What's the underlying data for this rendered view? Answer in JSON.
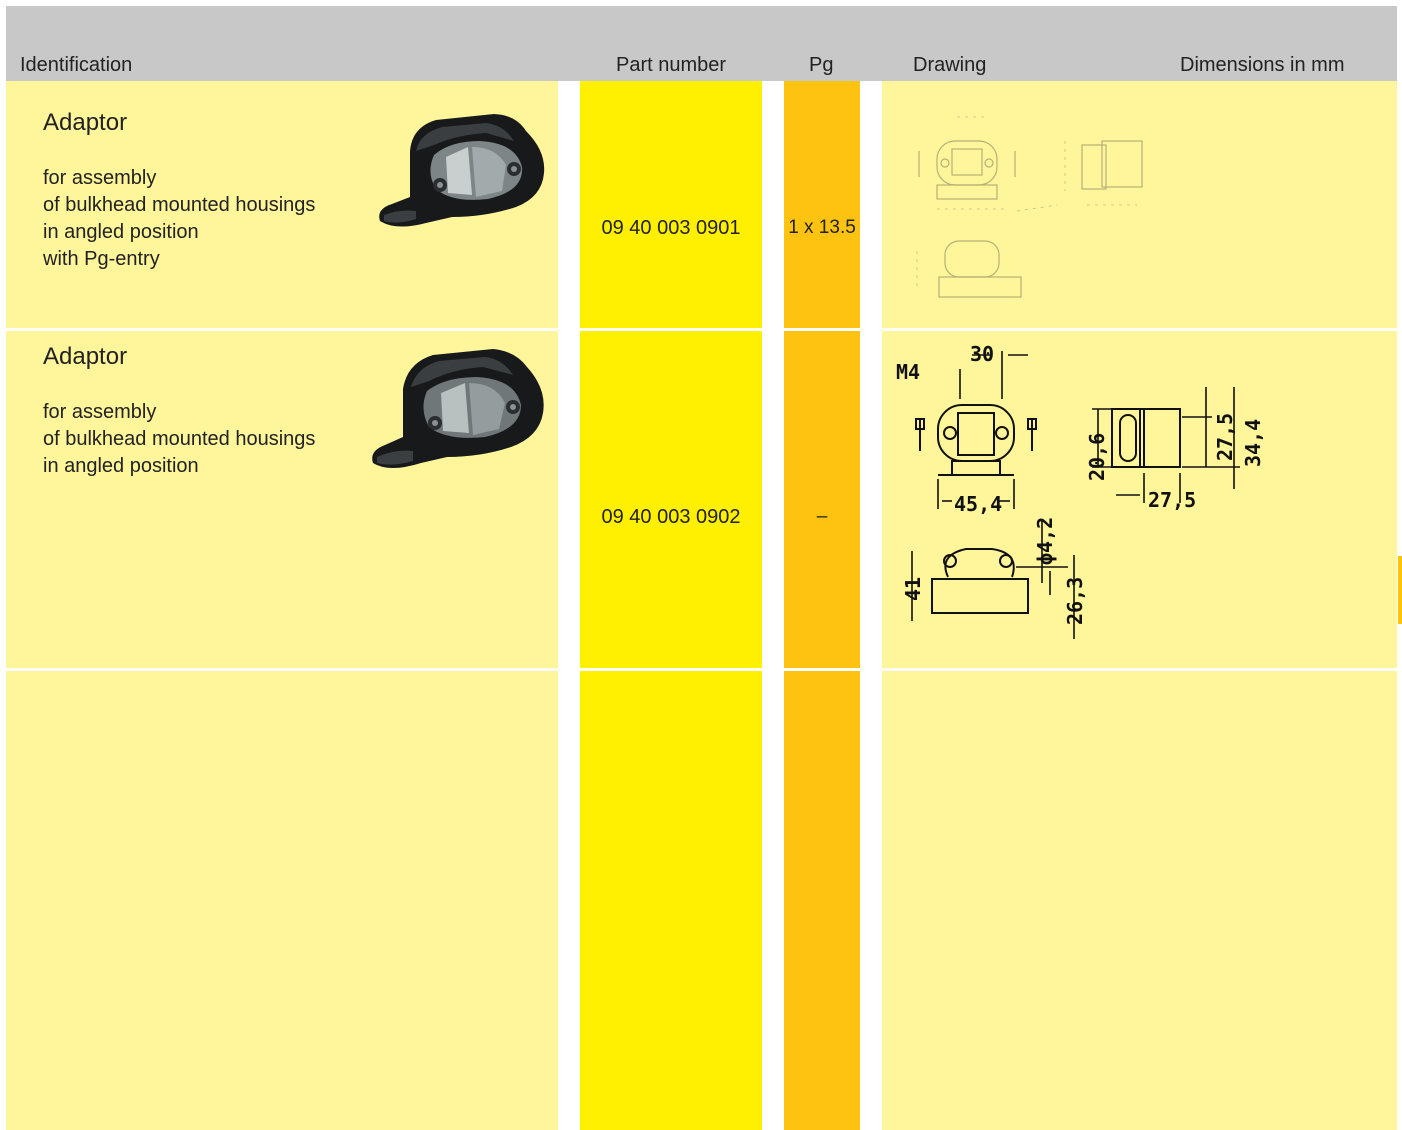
{
  "header": {
    "identification": "Identification",
    "part_number": "Part number",
    "pg": "Pg",
    "drawing": "Drawing",
    "dimensions": "Dimensions in mm"
  },
  "rows": [
    {
      "title": "Adaptor",
      "description": [
        "for assembly",
        "of bulkhead mounted housings",
        "in angled position",
        "with Pg-entry"
      ],
      "part_number": "09 40 003 0901",
      "pg": "1 x 13.5"
    },
    {
      "title": "Adaptor",
      "description": [
        "for assembly",
        "of bulkhead mounted housings",
        "in angled position"
      ],
      "part_number": "09 40 003 0902",
      "pg": "–",
      "drawing_labels": {
        "m4": "M4",
        "d30": "30",
        "d45": "45,4",
        "d20": "20,6",
        "d27a": "27,5",
        "d34": "34,4",
        "d27b": "27,5",
        "d42": "ϕ4,2",
        "d41": "41",
        "d26": "26,3"
      }
    }
  ],
  "colors": {
    "header": "#c8c8c8",
    "light_yellow": "#fff59b",
    "yellow": "#ffef00",
    "orange": "#fec311"
  }
}
